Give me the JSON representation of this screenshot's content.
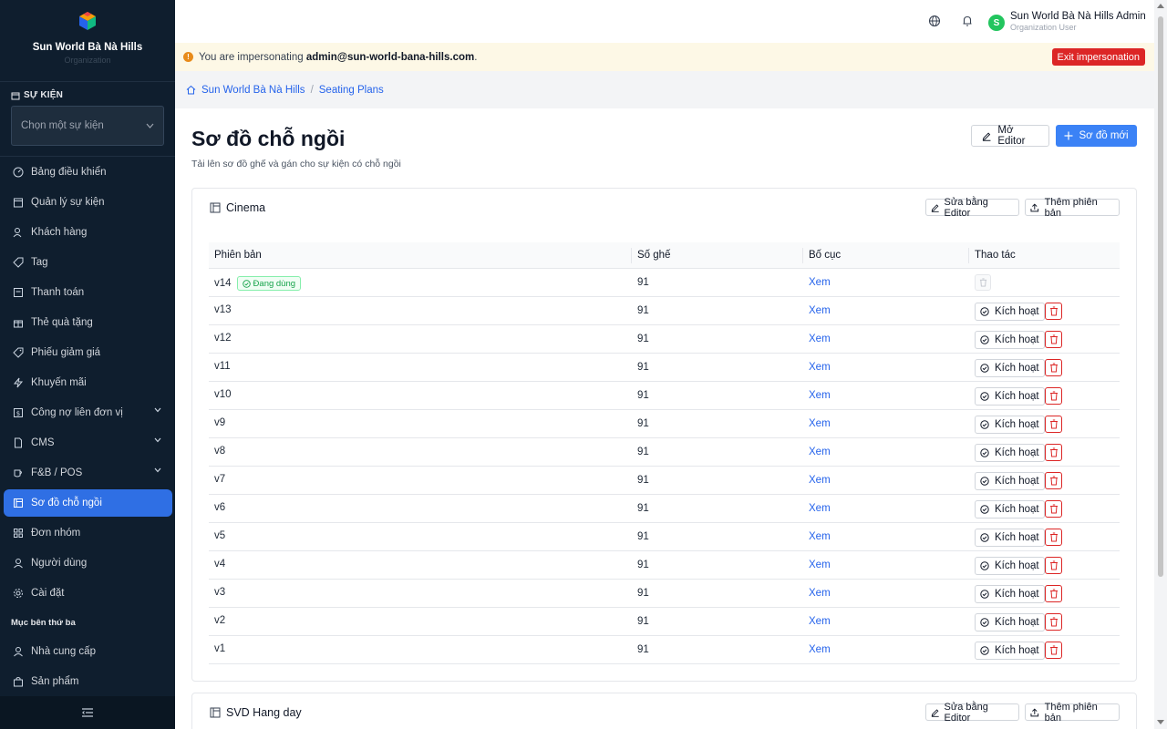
{
  "brand": {
    "name": "Sun World Bà Nà Hills",
    "subtitle": "Organization"
  },
  "sidebar": {
    "section_title": "SỰ KIỆN",
    "event_select_placeholder": "Chọn một sự kiện",
    "items": [
      {
        "label": "Bảng điều khiển",
        "icon": "dashboard-icon"
      },
      {
        "label": "Quản lý sự kiện",
        "icon": "calendar-icon"
      },
      {
        "label": "Khách hàng",
        "icon": "user-icon"
      },
      {
        "label": "Tag",
        "icon": "tag-icon"
      },
      {
        "label": "Thanh toán",
        "icon": "receipt-icon"
      },
      {
        "label": "Thẻ quà tặng",
        "icon": "gift-icon"
      },
      {
        "label": "Phiếu giảm giá",
        "icon": "coupon-icon"
      },
      {
        "label": "Khuyến mãi",
        "icon": "flash-icon"
      },
      {
        "label": "Công nợ liên đơn vị",
        "icon": "ledger-icon",
        "expandable": true
      },
      {
        "label": "CMS",
        "icon": "file-icon",
        "expandable": true
      },
      {
        "label": "F&B / POS",
        "icon": "cup-icon",
        "expandable": true
      },
      {
        "label": "Sơ đồ chỗ ngồi",
        "icon": "layout-icon",
        "active": true
      },
      {
        "label": "Đơn nhóm",
        "icon": "grid-icon"
      },
      {
        "label": "Người dùng",
        "icon": "person-icon"
      },
      {
        "label": "Cài đặt",
        "icon": "settings-icon"
      }
    ],
    "third_party_title": "Mục bên thứ ba",
    "third_party_items": [
      {
        "label": "Nhà cung cấp",
        "icon": "supplier-icon"
      },
      {
        "label": "Sản phẩm",
        "icon": "bag-icon"
      }
    ]
  },
  "topbar": {
    "user_initial": "S",
    "user_name": "Sun World Bà Nà Hills Admin",
    "user_role": "Organization User"
  },
  "banner": {
    "prefix": "You are impersonating ",
    "email": "admin@sun-world-bana-hills.com",
    "suffix": ".",
    "exit_label": "Exit impersonation"
  },
  "breadcrumb": {
    "home": "Sun World Bà Nà Hills",
    "current": "Seating Plans"
  },
  "page": {
    "title": "Sơ đồ chỗ ngồi",
    "subtitle": "Tải lên sơ đồ ghế và gán cho sự kiện có chỗ ngồi",
    "open_editor_label": "Mở Editor",
    "new_plan_label": "Sơ đồ mới"
  },
  "table_headers": {
    "version": "Phiên bản",
    "seats": "Số ghế",
    "layout": "Bố cục",
    "actions": "Thao tác"
  },
  "cards": [
    {
      "title": "Cinema",
      "edit_label": "Sửa bằng Editor",
      "add_version_label": "Thêm phiên bản",
      "rows": [
        {
          "version": "v14",
          "badge": "Đang dùng",
          "seats": "91",
          "view": "Xem",
          "active": true
        },
        {
          "version": "v13",
          "seats": "91",
          "view": "Xem",
          "activate": "Kích hoạt"
        },
        {
          "version": "v12",
          "seats": "91",
          "view": "Xem",
          "activate": "Kích hoạt"
        },
        {
          "version": "v11",
          "seats": "91",
          "view": "Xem",
          "activate": "Kích hoạt"
        },
        {
          "version": "v10",
          "seats": "91",
          "view": "Xem",
          "activate": "Kích hoạt"
        },
        {
          "version": "v9",
          "seats": "91",
          "view": "Xem",
          "activate": "Kích hoạt"
        },
        {
          "version": "v8",
          "seats": "91",
          "view": "Xem",
          "activate": "Kích hoạt"
        },
        {
          "version": "v7",
          "seats": "91",
          "view": "Xem",
          "activate": "Kích hoạt"
        },
        {
          "version": "v6",
          "seats": "91",
          "view": "Xem",
          "activate": "Kích hoạt"
        },
        {
          "version": "v5",
          "seats": "91",
          "view": "Xem",
          "activate": "Kích hoạt"
        },
        {
          "version": "v4",
          "seats": "91",
          "view": "Xem",
          "activate": "Kích hoạt"
        },
        {
          "version": "v3",
          "seats": "91",
          "view": "Xem",
          "activate": "Kích hoạt"
        },
        {
          "version": "v2",
          "seats": "91",
          "view": "Xem",
          "activate": "Kích hoạt"
        },
        {
          "version": "v1",
          "seats": "91",
          "view": "Xem",
          "activate": "Kích hoạt"
        }
      ]
    },
    {
      "title": "SVD Hang day",
      "edit_label": "Sửa bằng Editor",
      "add_version_label": "Thêm phiên bản"
    }
  ],
  "colors": {
    "sidebar_bg": "#0f1e2e",
    "accent": "#3b82f6",
    "danger": "#dc2626",
    "success": "#16a34a",
    "banner_bg": "#fdf8e6"
  }
}
